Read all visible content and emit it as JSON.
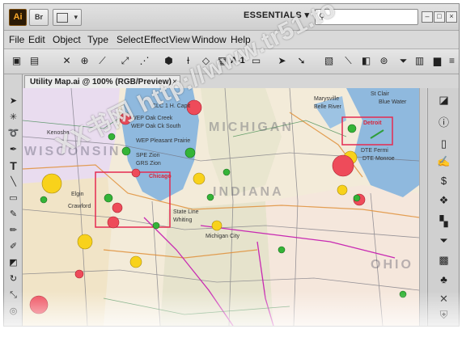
{
  "app": {
    "logo": "Ai",
    "bridge_label": "Br",
    "workspace": "ESSENTIALS",
    "search_value": ""
  },
  "menu": [
    "File",
    "Edit",
    "Object",
    "Type",
    "Select",
    "Effect",
    "View",
    "Window",
    "Help"
  ],
  "control_bar": {
    "a1_label": "A-1"
  },
  "document": {
    "tab_title": "Utility Map.ai @ 100% (RGB/Preview)",
    "close_glyph": "×"
  },
  "map": {
    "states": [
      "WISCONSIN",
      "MICHIGAN",
      "INDIANA",
      "OHIO"
    ],
    "city_labels": [
      "Chicago",
      "Detroit"
    ],
    "place_labels": [
      "CLC 1 H. Capit",
      "WEP Oak Creek",
      "WEP Oak Ck South",
      "WEP Pleasant Prairie",
      "SPE Zion",
      "GRS Zion",
      "Elgin",
      "Crawford",
      "State Line",
      "Whiting",
      "Michigan City",
      "Kenosha",
      "DTE Fermi",
      "DTE Monroe",
      "Blue Water",
      "Marysville",
      "Belle River",
      "St Clair"
    ],
    "colors": {
      "water": "#8fb9de",
      "land": "#f3ebd9",
      "marker_yellow": "#f8d21b",
      "marker_green": "#34b437",
      "marker_red": "#ee4b5a",
      "road_magenta": "#c829b2",
      "highlight_red": "#e52b50"
    }
  },
  "watermark": "XX书网 http://www.tr51.to",
  "icons": {
    "tools": [
      "selection-tool-icon",
      "direct-selection-icon",
      "magic-wand-icon",
      "lasso-icon",
      "pen-tool-icon",
      "type-tool-icon",
      "line-tool-icon",
      "rectangle-tool-icon",
      "paintbrush-icon",
      "pencil-icon",
      "blob-brush-icon",
      "eraser-icon",
      "rotate-tool-icon",
      "scale-tool-icon",
      "warp-tool-icon",
      "free-transform-icon"
    ],
    "panels": [
      "color-panel-icon",
      "color-guide-icon",
      "swatches-icon",
      "info-icon",
      "brushes-icon",
      "symbols-icon",
      "graphic-styles-icon",
      "appearance-icon",
      "align-icon",
      "pathfinder-icon",
      "stroke-icon",
      "gradient-icon",
      "transparency-icon",
      "layers-icon",
      "artboards-icon",
      "links-icon"
    ]
  }
}
